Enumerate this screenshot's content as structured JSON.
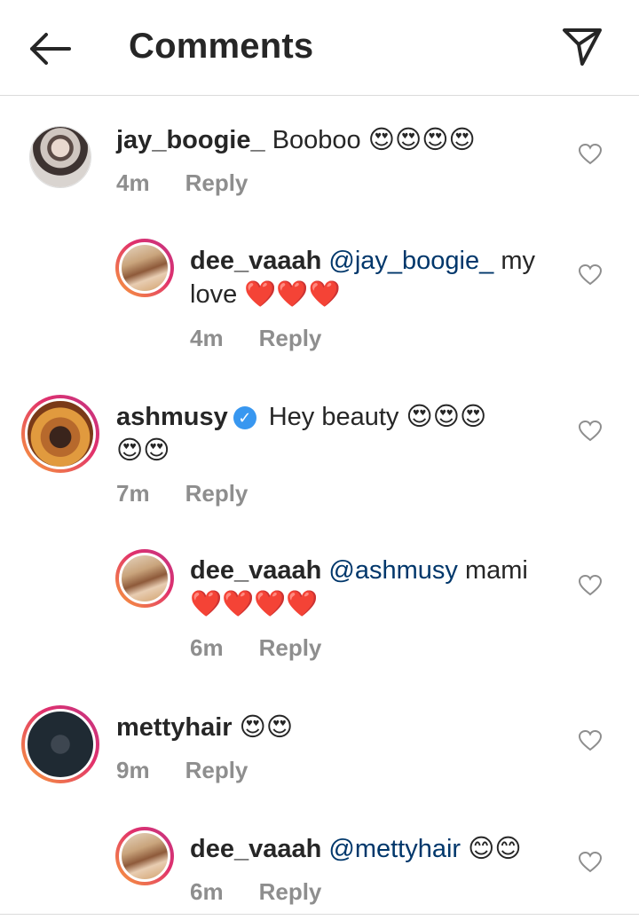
{
  "header": {
    "title": "Comments",
    "back_icon": "arrow-left-icon",
    "share_icon": "paper-plane-icon"
  },
  "comments": [
    {
      "user": "jay_boogie_",
      "text": "Booboo",
      "emoji": "😍😍😍😍",
      "time": "4m",
      "reply": "Reply",
      "verified": false
    },
    {
      "user": "dee_vaaah",
      "mention": "@jay_boogie_",
      "text": "my",
      "text2": "love",
      "emoji": "❤️❤️❤️",
      "time": "4m",
      "reply": "Reply"
    },
    {
      "user": "ashmusy",
      "text": "Hey beauty",
      "emoji": "😍😍😍",
      "emoji2": "😍😍",
      "time": "7m",
      "reply": "Reply",
      "verified": true
    },
    {
      "user": "dee_vaaah",
      "mention": "@ashmusy",
      "text": "mami",
      "emoji": "❤️❤️❤️❤️",
      "time": "6m",
      "reply": "Reply"
    },
    {
      "user": "mettyhair",
      "emoji": "😍😍",
      "time": "9m",
      "reply": "Reply"
    },
    {
      "user": "dee_vaaah",
      "mention": "@mettyhair",
      "emoji": "😊😊",
      "time": "6m",
      "reply": "Reply"
    }
  ],
  "colors": {
    "mention": "#00376b",
    "meta": "#8e8e8e",
    "verified": "#3897f0",
    "divider": "#dbdbdb"
  }
}
